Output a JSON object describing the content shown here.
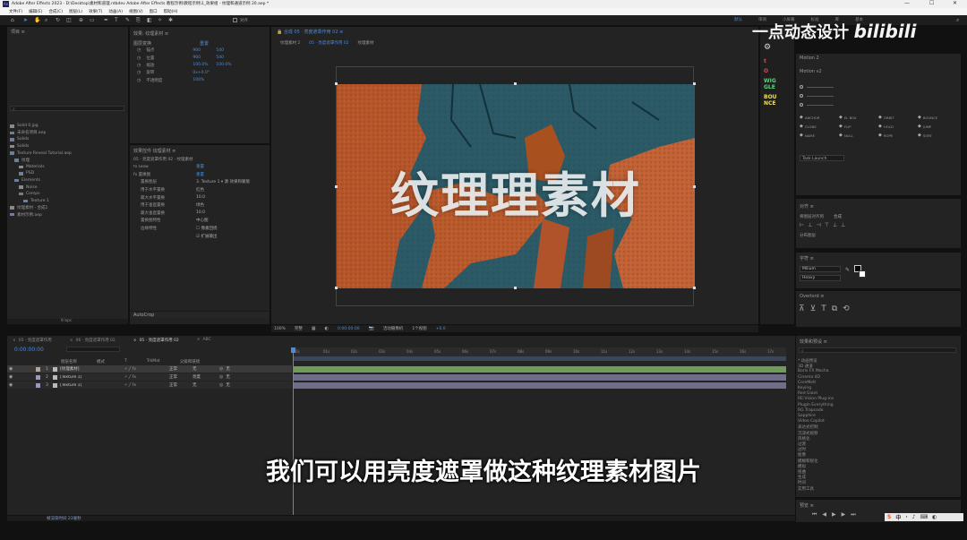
{
  "window": {
    "title": "Adobe After Effects 2023 - D:\\Desktop\\素材和道理.ntbdev Adobe After Effects 教程示例\\教程示例\\1_效果组 - 纹理和通道示例 20.aep *",
    "minimize": "—",
    "maximize": "☐",
    "close": "✕"
  },
  "menu": [
    "文件(F)",
    "编辑(E)",
    "合成(C)",
    "图层(L)",
    "效果(T)",
    "动画(A)",
    "视图(V)",
    "窗口",
    "帮助(H)"
  ],
  "workspace": {
    "tabs": [
      "默认",
      "审阅",
      "小屏幕",
      "标准",
      "库",
      "基本"
    ],
    "search_icon": "search-icon"
  },
  "watermark": {
    "text": "一点动态设计",
    "logo": "bilibili"
  },
  "project_panel": {
    "title": "项目 ≡",
    "search_placeholder": "⌕",
    "items": [
      {
        "name": "Solid 0.jpg",
        "indent": 0
      },
      {
        "name": "未命名项目.aep",
        "indent": 0
      },
      {
        "name": "Solids",
        "indent": 0
      },
      {
        "name": "Solids",
        "indent": 0
      },
      {
        "name": "Texture Reveal Tutorial.aep",
        "indent": 0
      },
      {
        "name": "纹理",
        "indent": 1
      },
      {
        "name": "Materials",
        "indent": 2
      },
      {
        "name": "PSD",
        "indent": 2
      },
      {
        "name": "Elements",
        "indent": 1
      },
      {
        "name": "Noise",
        "indent": 2
      },
      {
        "name": "Comps",
        "indent": 2
      },
      {
        "name": "Texture 1",
        "indent": 3
      },
      {
        "name": "纹理素材 - 合成1",
        "indent": 0
      },
      {
        "name": "素材示例.aep",
        "indent": 0
      }
    ],
    "footer_label": "8 bpc"
  },
  "effect_controls": {
    "title": "效果: 纹理素材 ≡",
    "header_left": "图层变换",
    "header_right": "重置",
    "rows": [
      {
        "name": "锚点",
        "v1": "960",
        "v2": "540"
      },
      {
        "name": "位置",
        "v1": "960",
        "v2": "540"
      },
      {
        "name": "缩放",
        "v1": "100.0%",
        "v2": "100.0%"
      },
      {
        "name": "旋转",
        "v1": "0x+0.0°",
        "v2": ""
      },
      {
        "name": "不透明度",
        "v1": "100%",
        "v2": ""
      }
    ]
  },
  "effect_controls2": {
    "title": "效果控件 纹理素材 ≡",
    "subtitle": "05 · 亮度遮罩作用 02 · 纹理素材",
    "rows": [
      {
        "name": "fx Glow",
        "value": "重置",
        "indent": 0
      },
      {
        "name": "fx 置换图",
        "value": "重置",
        "indent": 0
      },
      {
        "name": "置换图层",
        "value": "3. Texture 1 ▾  源  效果和蒙版",
        "indent": 1
      },
      {
        "name": "用于水平置换",
        "value": "红色",
        "indent": 1
      },
      {
        "name": "最大水平置换",
        "value": "10.0",
        "indent": 1
      },
      {
        "name": "用于垂直置换",
        "value": "绿色",
        "indent": 1
      },
      {
        "name": "最大垂直置换",
        "value": "10.0",
        "indent": 1
      },
      {
        "name": "置换图特性",
        "value": "中心图",
        "indent": 1
      },
      {
        "name": "边缘特性",
        "value": "☐ 像素回绕",
        "indent": 1
      },
      {
        "name": "",
        "value": "☑ 扩展输出",
        "indent": 1
      }
    ],
    "plugins": [
      "AutoCrop",
      "ZapaCopy"
    ]
  },
  "composition": {
    "tab_title": "合成 05 · 亮度遮罩作用 02 ≡",
    "breadcrumbs": [
      "纹理素材 2",
      "05 · 亮度遮罩作用 02",
      "纹理素材"
    ],
    "title_text": "纹理理素材",
    "zoom": "100%",
    "quality": "完整",
    "timecode": "0:00:00:00",
    "camera": "活动摄像机",
    "views": "1个视图",
    "offset": "+0.0"
  },
  "tool_icons": [
    {
      "name": "t",
      "color": "#d94a4a"
    },
    {
      "name": "O",
      "color": "#d94a4a"
    },
    {
      "name": "WIG GLE",
      "color": "#5ed47a"
    },
    {
      "name": "BOU NCE",
      "color": "#f0e14a"
    }
  ],
  "motion_panel": {
    "title": "Motion 2",
    "version": "Motion v2",
    "buttons": [
      "ANCHOR",
      "EL BOX",
      "ORBIT",
      "BOUNCE",
      "CLONE",
      "FLIP",
      "HOLD",
      "JUMP",
      "NAME",
      "NULL",
      "ROPE",
      "SORT"
    ],
    "task": "Task Launch"
  },
  "align_panel": {
    "title": "对齐 ≡",
    "align_to": "将图层对齐到",
    "align_to_value": "合成",
    "distribute": "分布图层"
  },
  "char_panel": {
    "title": "字符 ≡",
    "font": "Milium",
    "style": "Heavy"
  },
  "overlord_panel": {
    "title": "Overlord ≡"
  },
  "fx_panel": {
    "title": "效果和预设 ≡",
    "search_placeholder": "⌕",
    "categories": [
      "* 动画预设",
      "3D 通道",
      "Boris FX Mocha",
      "Cinema 4D",
      "CoreMelt",
      "Keying",
      "Red Giant",
      "RE:Vision Plug-ins",
      "Plugin Everything",
      "RG Trapcode",
      "Sapphire",
      "Video Copilot",
      "表达式控制",
      "沉浸式视频",
      "风格化",
      "过渡",
      "过时",
      "抠像",
      "模糊和锐化",
      "模拟",
      "扭曲",
      "生成",
      "时间",
      "实用工具"
    ]
  },
  "preview_panel": {
    "title": "预览 ≡"
  },
  "timeline": {
    "tabs": [
      "05 · 亮度遮罩作用",
      "06 · 亮度遮罩作用 02",
      "05 · 亮度遮罩作用 02",
      "ABC"
    ],
    "timecode": "0:00:00:00",
    "columns": [
      "图层名称",
      "模式",
      "T",
      "TrkMat",
      "父级和链接"
    ],
    "layers": [
      {
        "num": "1",
        "name": "[纹理素材]",
        "mode": "正常",
        "trk": "无",
        "parent": "无",
        "color": "#b0a8a0",
        "bar": "#6f9a5a"
      },
      {
        "num": "2",
        "name": "[Texture 1]",
        "mode": "正常",
        "trk": "亮度",
        "parent": "无",
        "color": "#9a9ab8",
        "bar": "#6e6e8a"
      },
      {
        "num": "3",
        "name": "[Texture 1]",
        "mode": "正常",
        "trk": "无",
        "parent": "无",
        "color": "#9a9ab8",
        "bar": "#6e6e8a"
      }
    ],
    "ruler": [
      "0s",
      "01s",
      "02s",
      "03s",
      "04s",
      "05s",
      "06s",
      "07s",
      "08s",
      "09s",
      "10s",
      "11s",
      "12s",
      "13s",
      "14s",
      "15s",
      "16s",
      "17s"
    ],
    "footer": "帧渲染时间 23毫秒"
  },
  "subtitle": "我们可以用亮度遮罩做这种纹理素材图片",
  "taskbar": {
    "tray": [
      "S",
      "中",
      "·",
      "♪",
      "⌨",
      "◐"
    ]
  }
}
